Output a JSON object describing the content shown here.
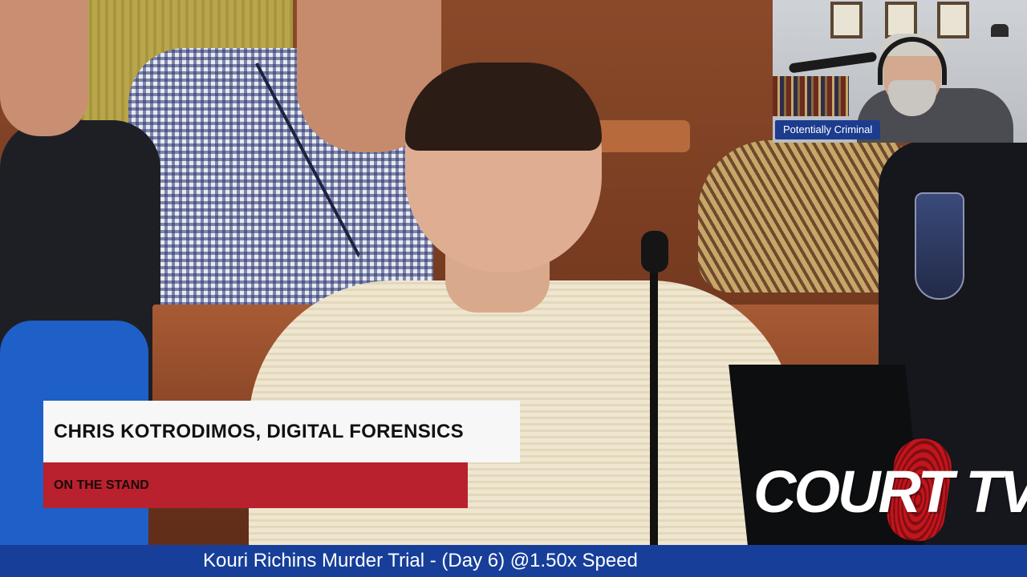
{
  "video": {
    "inset": {
      "label": "Potentially Criminal"
    },
    "lower_third": {
      "name_title": "CHRIS KOTRODIMOS, DIGITAL FORENSICS",
      "subtitle": "ON THE STAND"
    },
    "logo": {
      "text": "COURT TV"
    },
    "ticker": {
      "text": "Kouri Richins Murder Trial - (Day 6) @1.50x Speed"
    }
  },
  "colors": {
    "ticker_bg": "#173f9a",
    "lower_third_red": "#b8212d",
    "lower_third_white": "#f7f7f7",
    "inset_label_bg": "#1c3c8e",
    "logo_red": "#c4141c"
  }
}
